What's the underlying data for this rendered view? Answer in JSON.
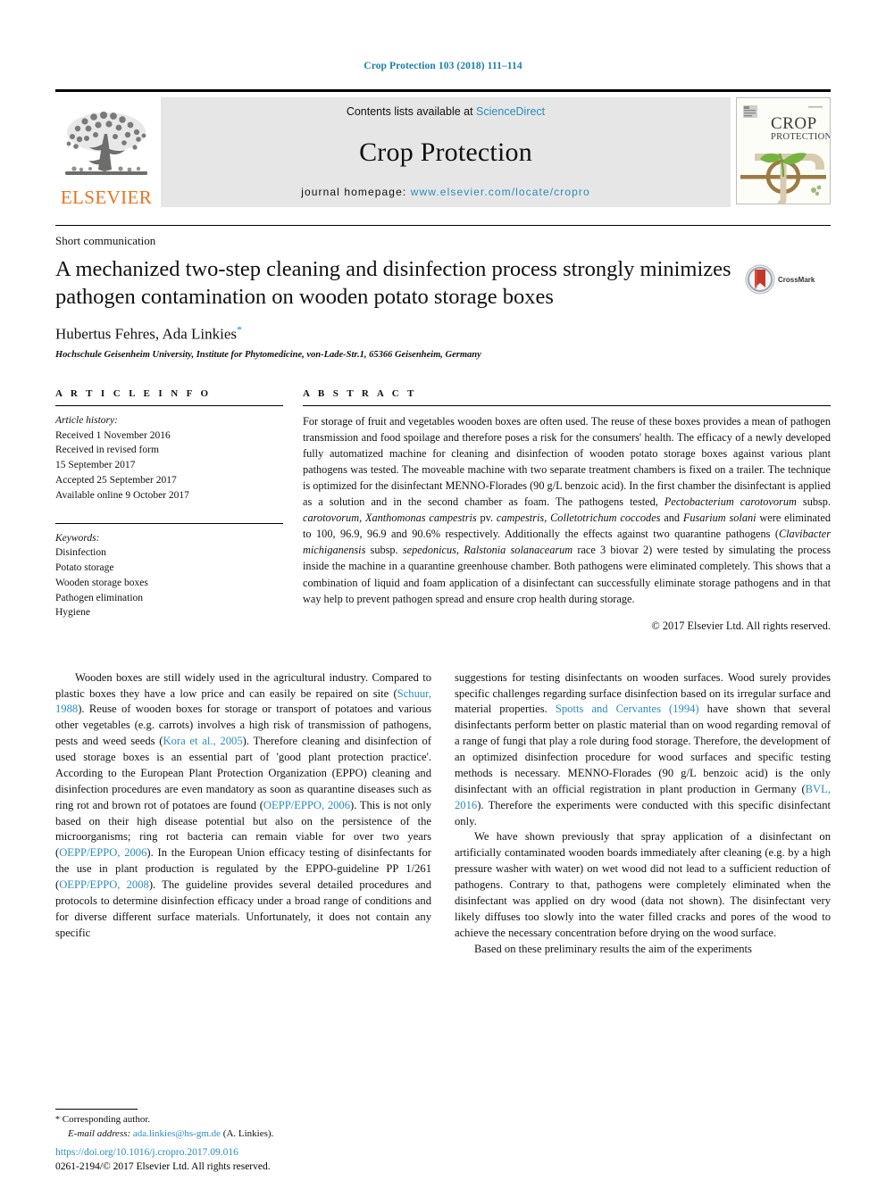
{
  "running_head": "Crop Protection 103 (2018) 111–114",
  "masthead": {
    "publisher_name": "ELSEVIER",
    "contents_prefix": "Contents lists available at ",
    "contents_link": "ScienceDirect",
    "journal_title": "Crop Protection",
    "homepage_prefix": "journal homepage: ",
    "homepage_link": "www.elsevier.com/locate/cropro",
    "cover_title_line1": "CROP",
    "cover_title_line2": "PROTECTION",
    "link_color": "#2b8cbe",
    "elsevier_orange": "#E9711C"
  },
  "article": {
    "type": "Short communication",
    "title": "A mechanized two-step cleaning and disinfection process strongly minimizes pathogen contamination on wooden potato storage boxes",
    "authors": "Hubertus Fehres, Ada Linkies",
    "corresponding_marker": "*",
    "affiliation": "Hochschule Geisenheim University, Institute for Phytomedicine, von-Lade-Str.1, 65366 Geisenheim, Germany",
    "crossmark_label": "CrossMark"
  },
  "article_info": {
    "heading": "A R T I C L E   I N F O",
    "history_label": "Article history:",
    "history": [
      "Received 1 November 2016",
      "Received in revised form",
      "15 September 2017",
      "Accepted 25 September 2017",
      "Available online 9 October 2017"
    ],
    "keywords_label": "Keywords:",
    "keywords": [
      "Disinfection",
      "Potato storage",
      "Wooden storage boxes",
      "Pathogen elimination",
      "Hygiene"
    ]
  },
  "abstract": {
    "heading": "A B S T R A C T",
    "part1": "For storage of fruit and vegetables wooden boxes are often used. The reuse of these boxes provides a mean of pathogen transmission and food spoilage and therefore poses a risk for the consumers' health. The efficacy of a newly developed fully automatized machine for cleaning and disinfection of wooden potato storage boxes against various plant pathogens was tested. The moveable machine with two separate treatment chambers is fixed on a trailer. The technique is optimized for the disinfectant MENNO-Florades (90 g/L benzoic acid). In the first chamber the disinfectant is applied as a solution and in the second chamber as foam. The pathogens tested, ",
    "italic1": "Pectobacterium carotovorum",
    "part2": " subsp. ",
    "italic2": "carotovorum, Xanthomonas campestris",
    "part3": " pv. ",
    "italic3": "campestris, Colletotrichum coccodes",
    "part4": " and ",
    "italic4": "Fusarium solani",
    "part5": " were eliminated to 100, 96.9, 96.9 and 90.6% respectively. Additionally the effects against two quarantine pathogens (",
    "italic5": "Clavibacter michiganensis",
    "part6": " subsp. ",
    "italic6": "sepedonicus, Ralstonia solanacearum",
    "part7": " race 3 biovar 2) were tested by simulating the process inside the machine in a quarantine greenhouse chamber. Both pathogens were eliminated completely. This shows that a combination of liquid and foam application of a disinfectant can successfully eliminate storage pathogens and in that way help to prevent pathogen spread and ensure crop health during storage.",
    "copyright": "© 2017 Elsevier Ltd. All rights reserved."
  },
  "body": {
    "left": {
      "p1_a": "Wooden boxes are still widely used in the agricultural industry. Compared to plastic boxes they have a low price and can easily be repaired on site (",
      "ref1": "Schuur, 1988",
      "p1_b": "). Reuse of wooden boxes for storage or transport of potatoes and various other vegetables (e.g. carrots) involves a high risk of transmission of pathogens, pests and weed seeds (",
      "ref2": "Kora et al., 2005",
      "p1_c": "). Therefore cleaning and disinfection of used storage boxes is an essential part of 'good plant protection practice'. According to the European Plant Protection Organization (EPPO) cleaning and disinfection procedures are even mandatory as soon as quarantine diseases such as ring rot and brown rot of potatoes are found (",
      "ref3": "OEPP/EPPO, 2006",
      "p1_d": "). This is not only based on their high disease potential but also on the persistence of the microorganisms; ring rot bacteria can remain viable for over two years (",
      "ref4": "OEPP/EPPO, 2006",
      "p1_e": "). In the European Union efficacy testing of disinfectants for the use in plant production is regulated by the EPPO-guideline PP 1/261 (",
      "ref5": "OEPP/EPPO, 2008",
      "p1_f": "). The guideline provides several detailed procedures and protocols to determine disinfection efficacy under a broad range of conditions and for diverse different surface materials. Unfortunately, it does not contain any specific"
    },
    "right": {
      "p1_a": "suggestions for testing disinfectants on wooden surfaces. Wood surely provides specific challenges regarding surface disinfection based on its irregular surface and material properties. ",
      "ref1": "Spotts and Cervantes (1994)",
      "p1_b": " have shown that several disinfectants perform better on plastic material than on wood regarding removal of a range of fungi that play a role during food storage. Therefore, the development of an optimized disinfection procedure for wood surfaces and specific testing methods is necessary. MENNO-Florades (90 g/L benzoic acid) is the only disinfectant with an official registration in plant production in Germany (",
      "ref2": "BVL, 2016",
      "p1_c": "). Therefore the experiments were conducted with this specific disinfectant only.",
      "p2": "We have shown previously that spray application of a disinfectant on artificially contaminated wooden boards immediately after cleaning (e.g. by a high pressure washer with water) on wet wood did not lead to a sufficient reduction of pathogens. Contrary to that, pathogens were completely eliminated when the disinfectant was applied on dry wood (data not shown). The disinfectant very likely diffuses too slowly into the water filled cracks and pores of the wood to achieve the necessary concentration before drying on the wood surface.",
      "p3": "Based on these preliminary results the aim of the experiments"
    }
  },
  "footer": {
    "corresponding_star": "*",
    "corresponding_author": "Corresponding author.",
    "email_label": "E-mail address:",
    "email": "ada.linkies@hs-gm.de",
    "email_suffix": "(A. Linkies).",
    "doi": "https://doi.org/10.1016/j.cropro.2017.09.016",
    "issn_line": "0261-2194/© 2017 Elsevier Ltd. All rights reserved."
  }
}
